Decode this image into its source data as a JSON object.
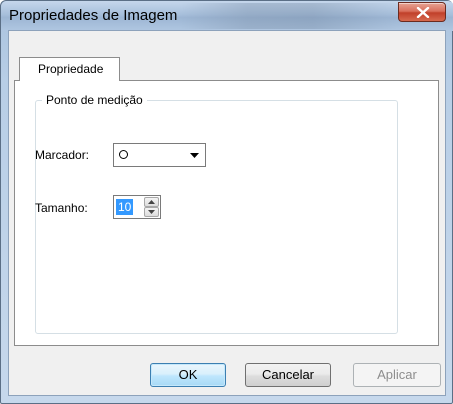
{
  "window": {
    "title": "Propriedades de Imagem"
  },
  "tabs": [
    {
      "label": "Propriedade",
      "active": true
    }
  ],
  "group": {
    "title": "Ponto de medição"
  },
  "fields": {
    "marker": {
      "label": "Marcador:",
      "selected_icon": "circle-outline-icon"
    },
    "size": {
      "label": "Tamanho:",
      "value": "10"
    }
  },
  "buttons": {
    "ok": "OK",
    "cancel": "Cancelar",
    "apply": "Aplicar"
  },
  "colors": {
    "selection": "#3399ff",
    "close_button": "#c1402a",
    "default_button_border": "#3c7fb1"
  }
}
